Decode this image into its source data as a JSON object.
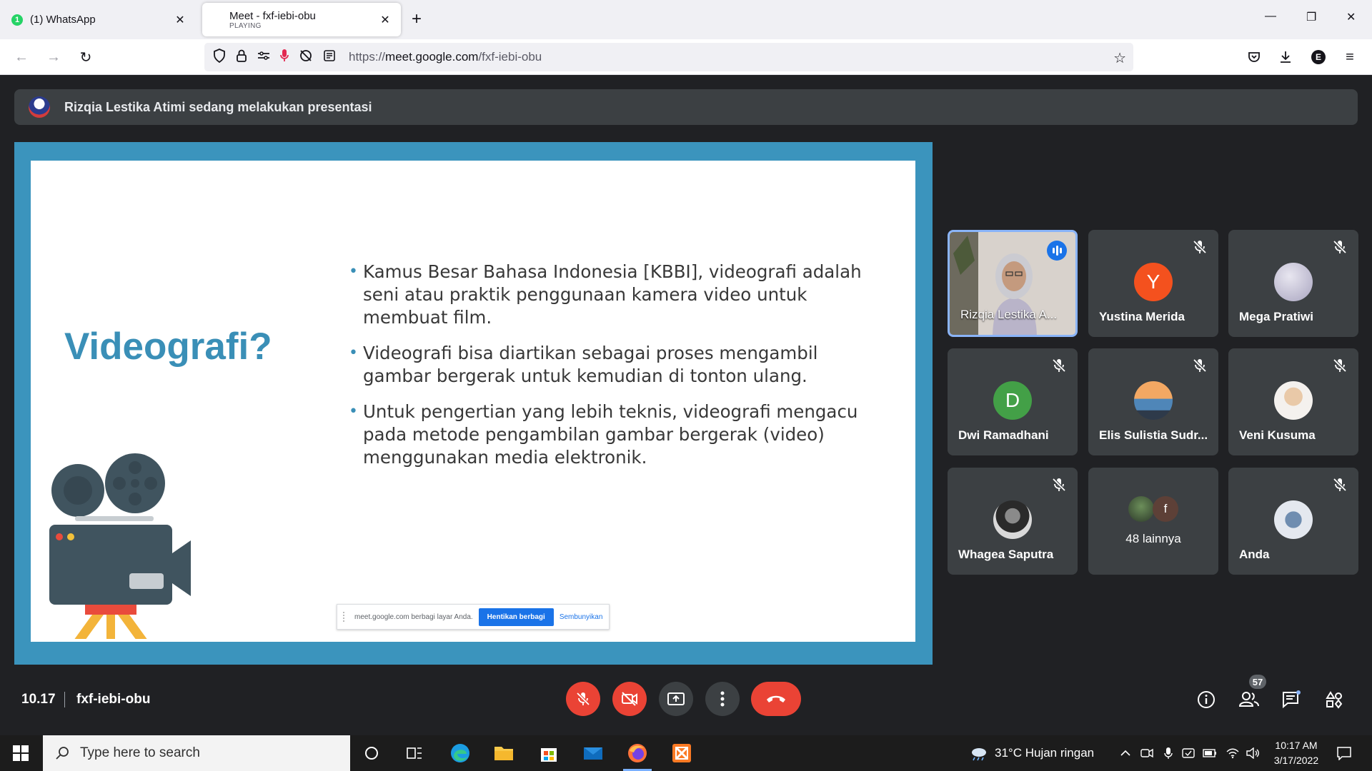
{
  "browser": {
    "tabs": [
      {
        "badge": "1",
        "title": "(1) WhatsApp",
        "subtitle": ""
      },
      {
        "title": "Meet - fxf-iebi-obu",
        "subtitle": "PLAYING"
      }
    ],
    "new_tab": "+",
    "url_host": "meet.google.com",
    "url_prefix": "https://",
    "url_path": "/fxf-iebi-obu",
    "profile_initial": "E"
  },
  "meet": {
    "presenter_banner": "Rizqia Lestika Atimi sedang melakukan presentasi",
    "slide": {
      "title": "Videografi?",
      "bullets": [
        "Kamus Besar Bahasa Indonesia [KBBI], videografi adalah seni atau praktik penggunaan kamera video untuk membuat film.",
        "Videografi bisa diartikan sebagai proses mengambil gambar bergerak untuk kemudian di tonton ulang.",
        "Untuk pengertian yang lebih teknis, videografi mengacu pada metode pengambilan gambar bergerak (video) menggunakan media elektronik."
      ],
      "share_bar": {
        "message": "meet.google.com berbagi layar Anda.",
        "stop_label": "Hentikan berbagi",
        "hide_label": "Sembunyikan"
      }
    },
    "participants": [
      {
        "name": "Rizqia Lestika A...",
        "speaking": true
      },
      {
        "name": "Yustina Merida",
        "initial": "Y",
        "color": "#f4511e"
      },
      {
        "name": "Mega Pratiwi"
      },
      {
        "name": "Dwi Ramadhani",
        "initial": "D",
        "color": "#43a047"
      },
      {
        "name": "Elis Sulistia Sudr..."
      },
      {
        "name": "Veni Kusuma"
      },
      {
        "name": "Whagea Saputra"
      },
      {
        "name": "48 lainnya",
        "mini_initial": "f"
      },
      {
        "name": "Anda"
      }
    ],
    "meeting_time": "10.17",
    "meeting_code": "fxf-iebi-obu",
    "participant_count": "57"
  },
  "taskbar": {
    "search_placeholder": "Type here to search",
    "weather": "31°C  Hujan ringan",
    "time": "10:17 AM",
    "date": "3/17/2022"
  },
  "colors": {
    "meet_bg": "#202124",
    "tile_bg": "#3c4043",
    "danger": "#ea4335",
    "slide_frame": "#3b94bd",
    "slide_accent": "#3a8fb7"
  }
}
